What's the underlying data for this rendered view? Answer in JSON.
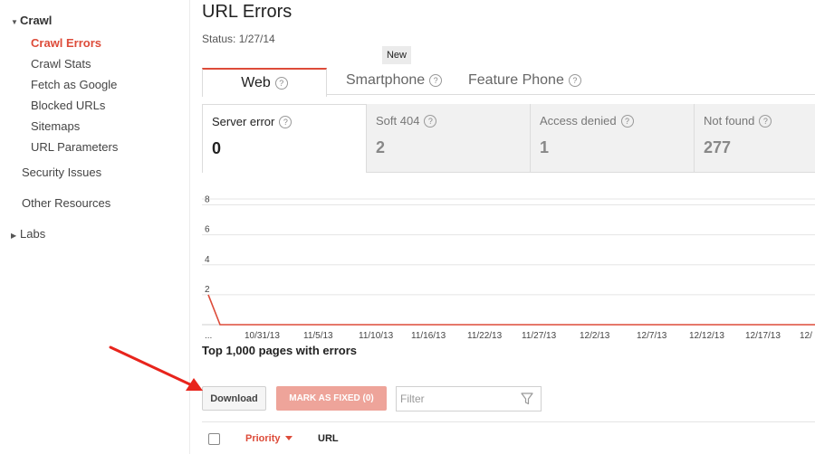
{
  "sidebar": {
    "crawl_label": "Crawl",
    "items": [
      {
        "label": "Crawl Errors",
        "active": true
      },
      {
        "label": "Crawl Stats"
      },
      {
        "label": "Fetch as Google"
      },
      {
        "label": "Blocked URLs"
      },
      {
        "label": "Sitemaps"
      },
      {
        "label": "URL Parameters"
      }
    ],
    "security_issues": "Security Issues",
    "other_resources": "Other Resources",
    "labs": "Labs"
  },
  "page": {
    "title": "URL Errors",
    "status": "Status: 1/27/14"
  },
  "tabs": {
    "new_badge": "New",
    "items": [
      {
        "label": "Web",
        "active": true
      },
      {
        "label": "Smartphone"
      },
      {
        "label": "Feature Phone"
      }
    ]
  },
  "cards": [
    {
      "label": "Server error",
      "value": "0",
      "active": true
    },
    {
      "label": "Soft 404",
      "value": "2"
    },
    {
      "label": "Access denied",
      "value": "1"
    },
    {
      "label": "Not found",
      "value": "277"
    }
  ],
  "chart_data": {
    "type": "line",
    "y_ticks": [
      "8",
      "6",
      "4",
      "2"
    ],
    "ylim": [
      0,
      9
    ],
    "x_ticks": [
      "...",
      "10/31/13",
      "11/5/13",
      "11/10/13",
      "11/16/13",
      "11/22/13",
      "11/27/13",
      "12/2/13",
      "12/7/13",
      "12/12/13",
      "12/17/13",
      "12/"
    ],
    "series": [
      {
        "values": [
          2,
          0,
          0,
          0,
          0,
          0,
          0,
          0,
          0,
          0,
          0,
          0,
          0,
          0,
          0,
          0,
          0,
          0,
          0,
          0,
          0,
          0,
          0,
          0,
          0,
          0,
          0,
          0,
          0,
          0,
          0,
          0,
          0,
          0,
          0,
          0,
          0,
          0,
          0,
          0,
          0,
          0,
          0,
          0,
          0,
          0,
          0,
          0,
          0,
          0,
          0,
          0,
          0,
          0,
          0,
          0,
          0,
          0,
          0,
          0,
          0,
          0
        ],
        "color": "#dd4b39"
      }
    ],
    "grid": true
  },
  "table": {
    "caption": "Top 1,000 pages with errors",
    "download_label": "Download",
    "mark_fixed_label": "MARK AS FIXED (0)",
    "filter_placeholder": "Filter",
    "filter_value": "",
    "columns": [
      "Priority",
      "URL"
    ]
  },
  "colors": {
    "accent": "#dd4b39",
    "mark_fixed_bg": "#eea49a"
  },
  "icons": {
    "help": "help-circle-icon",
    "filter": "funnel-icon",
    "expand": "triangle-down-icon",
    "collapse": "triangle-right-icon"
  }
}
